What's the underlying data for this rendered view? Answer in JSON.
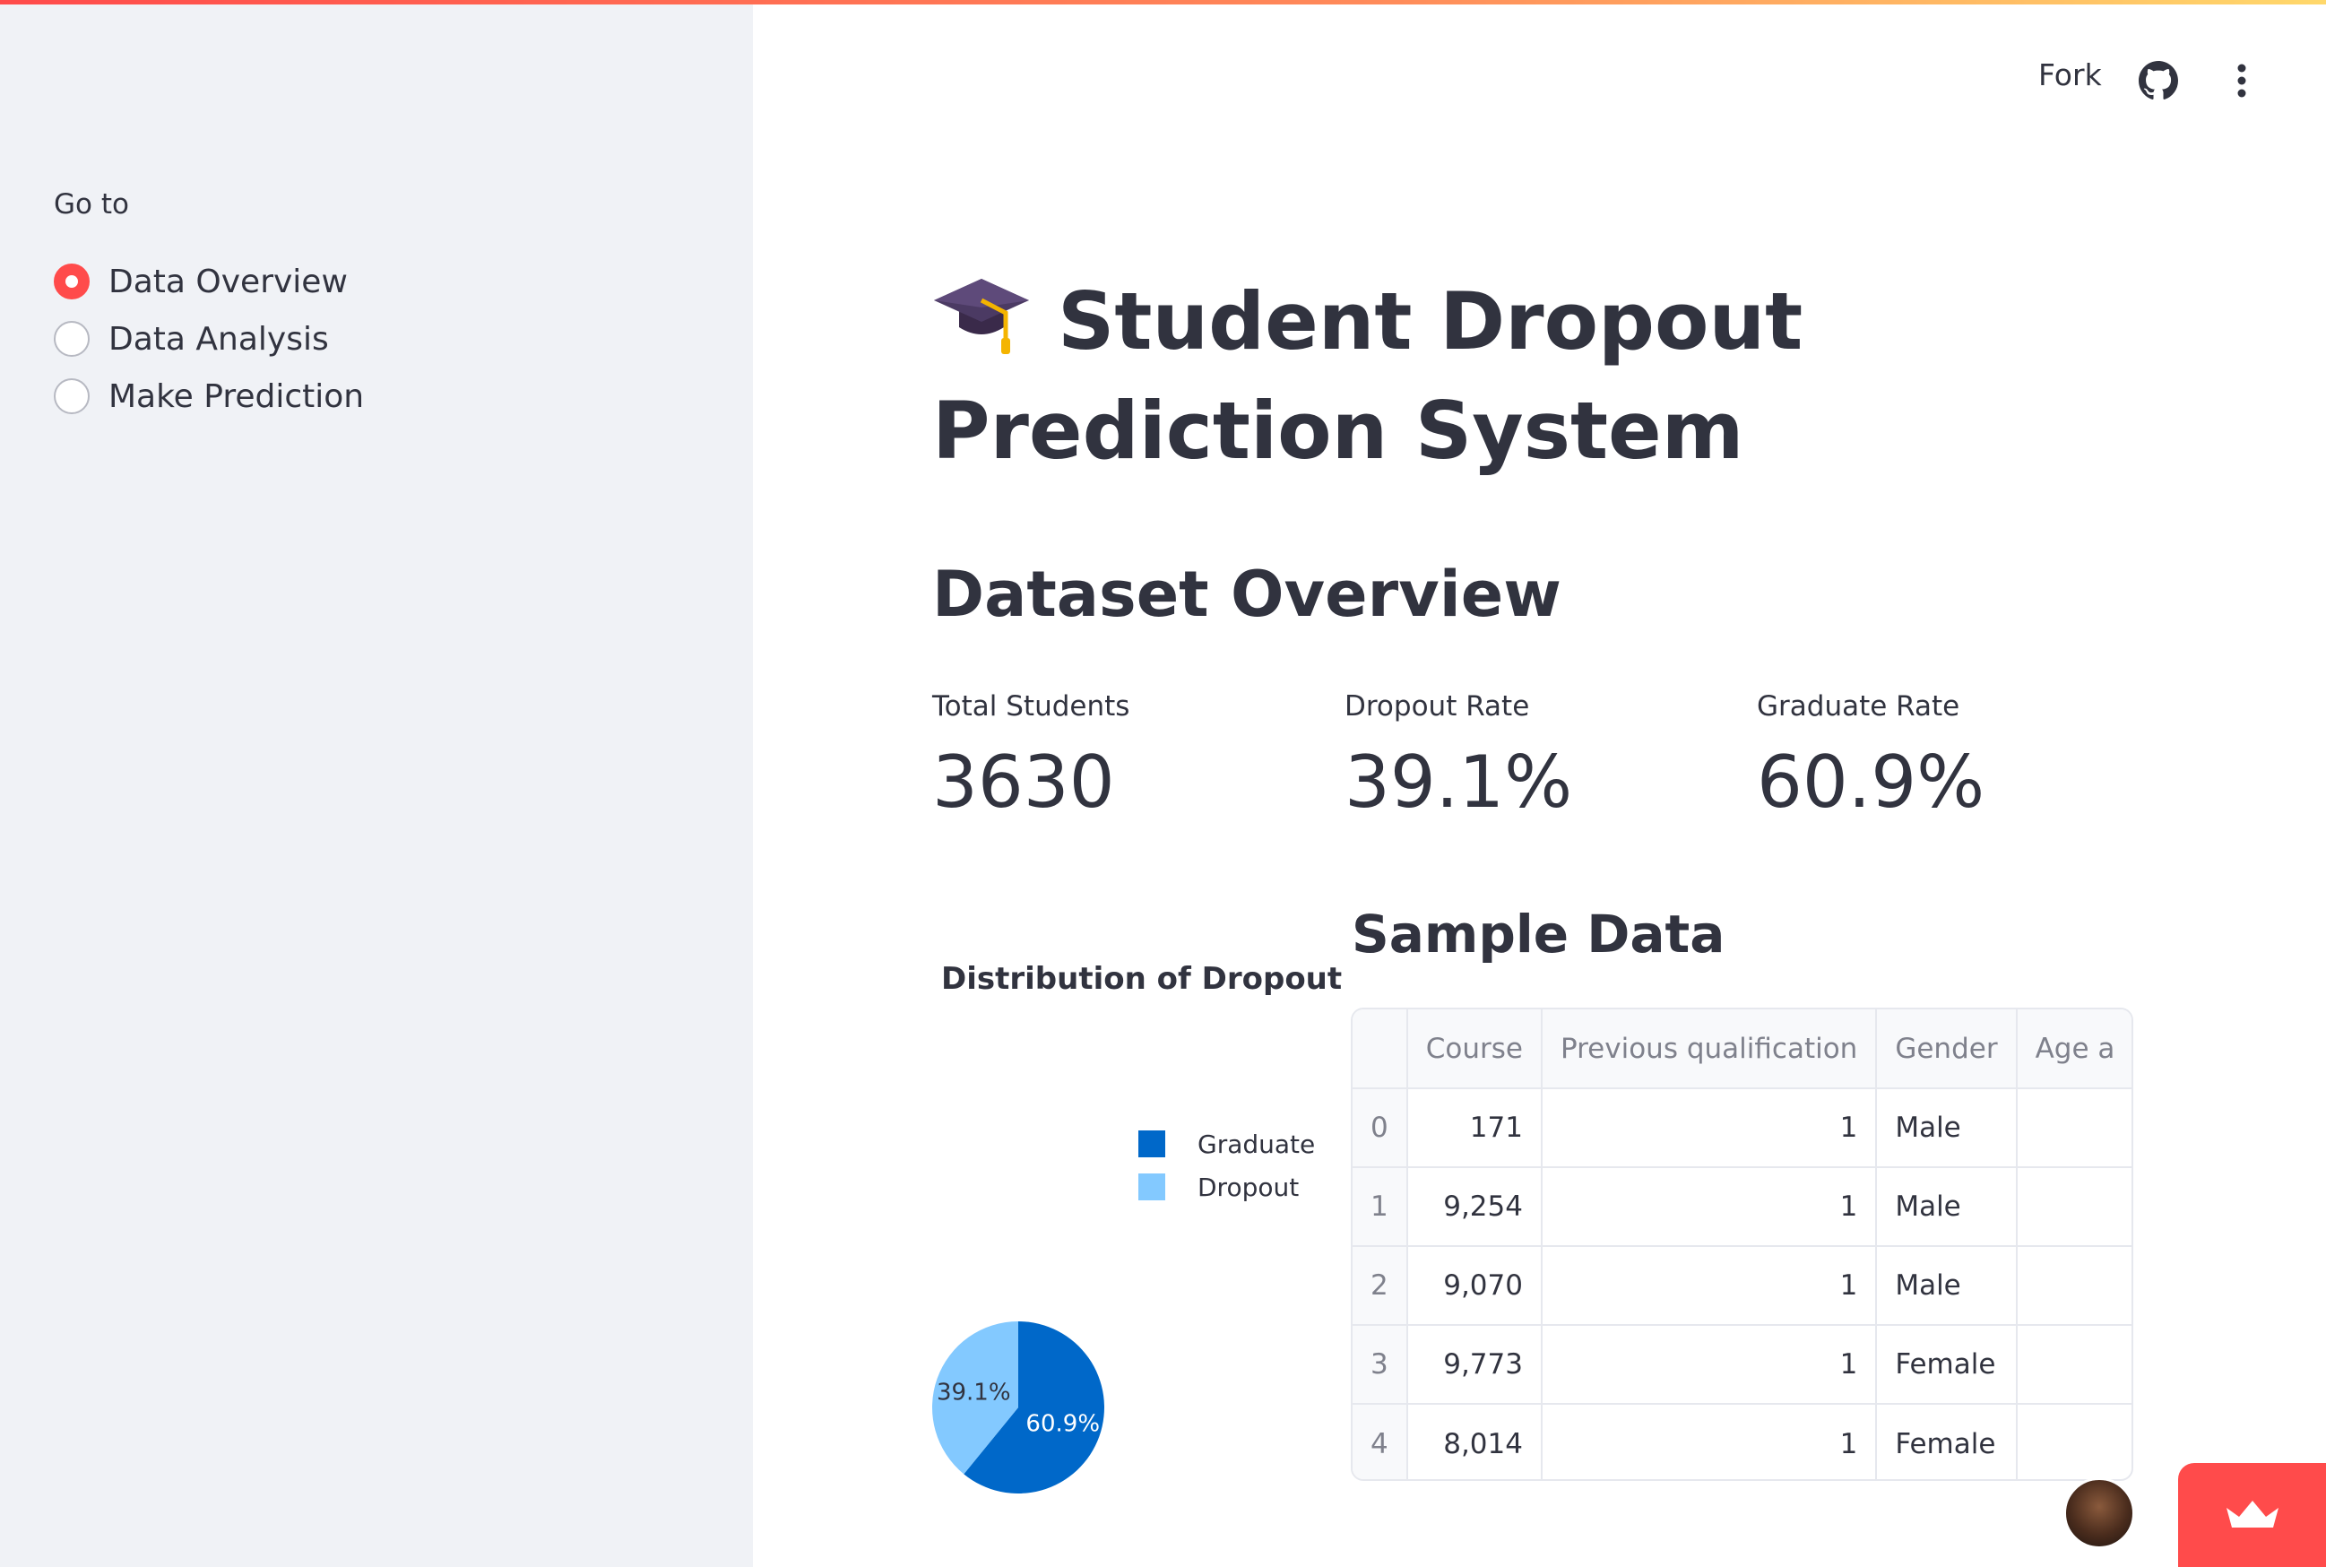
{
  "header": {
    "fork_label": "Fork"
  },
  "sidebar": {
    "goto_label": "Go to",
    "options": [
      {
        "label": "Data Overview",
        "selected": true
      },
      {
        "label": "Data Analysis",
        "selected": false
      },
      {
        "label": "Make Prediction",
        "selected": false
      }
    ]
  },
  "main": {
    "title": "Student Dropout Prediction System",
    "overview_heading": "Dataset Overview",
    "metrics": [
      {
        "label": "Total Students",
        "value": "3630"
      },
      {
        "label": "Dropout Rate",
        "value": "39.1%"
      },
      {
        "label": "Graduate Rate",
        "value": "60.9%"
      }
    ],
    "sample_heading": "Sample Data",
    "table": {
      "columns": [
        "",
        "Course",
        "Previous qualification",
        "Gender",
        "Age a"
      ],
      "rows": [
        [
          "0",
          "171",
          "1",
          "Male",
          ""
        ],
        [
          "1",
          "9,254",
          "1",
          "Male",
          ""
        ],
        [
          "2",
          "9,070",
          "1",
          "Male",
          ""
        ],
        [
          "3",
          "9,773",
          "1",
          "Female",
          ""
        ],
        [
          "4",
          "8,014",
          "1",
          "Female",
          ""
        ]
      ]
    }
  },
  "chart_data": {
    "type": "pie",
    "title": "Distribution of Dropout",
    "categories": [
      "Graduate",
      "Dropout"
    ],
    "values": [
      60.9,
      39.1
    ],
    "labels": [
      "60.9%",
      "39.1%"
    ],
    "colors": [
      "#0068c9",
      "#83c9ff"
    ],
    "legend_position": "top-right"
  },
  "colors": {
    "accent": "#ff4b4b",
    "sidebar_bg": "#f0f2f6",
    "text": "#31333f"
  }
}
